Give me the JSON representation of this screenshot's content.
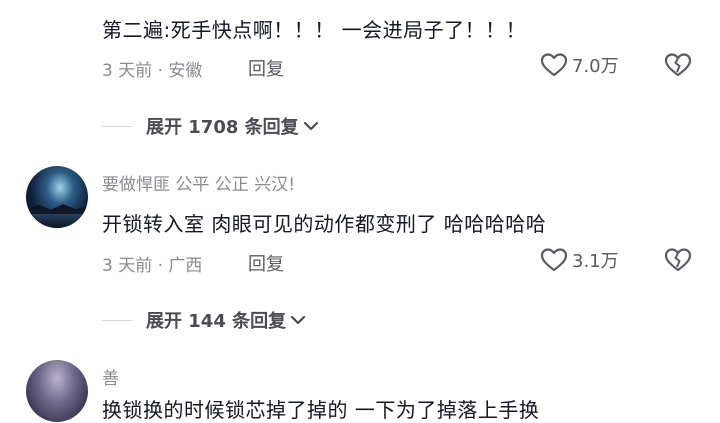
{
  "comments": [
    {
      "text": "第二遍:死手快点啊！！！ 一会进局子了！！！",
      "time_location": "3 天前 · 安徽",
      "reply_label": "回复",
      "likes": "7.0万",
      "expand_label": "展开 1708 条回复"
    },
    {
      "username": "要做悍匪 公平 公正  兴汉!",
      "text": "开锁转入室 肉眼可见的动作都变刑了 哈哈哈哈哈",
      "time_location": "3 天前 · 广西",
      "reply_label": "回复",
      "likes": "3.1万",
      "expand_label": "展开 144 条回复"
    },
    {
      "username": "善",
      "text": "换锁换的时候锁芯掉了掉的 一下为了掉落上手换"
    }
  ],
  "icons": {
    "like": "heart-outline-icon",
    "dislike": "broken-heart-icon",
    "expand": "chevron-down-icon"
  },
  "colors": {
    "text_primary": "#161823",
    "text_secondary": "#8a8b91"
  }
}
